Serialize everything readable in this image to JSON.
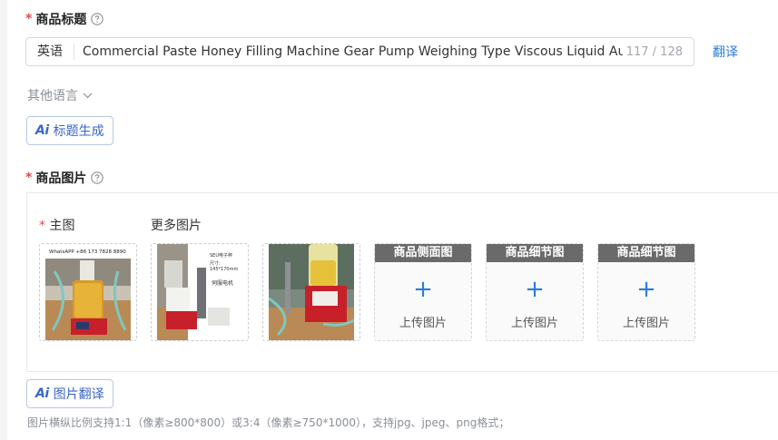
{
  "title_section": {
    "label": "商品标题",
    "language": "英语",
    "value": "Commercial Paste Honey Filling Machine Gear Pump Weighing Type Viscous Liquid Aut",
    "count": "117 / 128",
    "translate_label": "翻译",
    "other_lang_label": "其他语言",
    "ai_button_label": "标题生成"
  },
  "image_section": {
    "label": "商品图片",
    "main_label": "主图",
    "more_label": "更多图片",
    "main_image_text": "WhatsAPP +86 173 7828 8890",
    "thumb2_text_1": "SEU电子秤",
    "thumb2_text_2": "尺寸:",
    "thumb2_text_3": "145*170mm",
    "thumb2_text_4": "伺服电机",
    "slots": [
      {
        "title": "商品侧面图",
        "upload_label": "上传图片"
      },
      {
        "title": "商品细节图",
        "upload_label": "上传图片"
      },
      {
        "title": "商品细节图",
        "upload_label": "上传图片"
      }
    ],
    "ai_button_label": "图片翻译",
    "hint": "图片横纵比例支持1:1（像素≥800*800）或3:4（像素≥750*1000），支持jpg、jpeg、png格式；"
  },
  "ai_glyph": "Ai",
  "colors": {
    "accent": "#2e7bd6",
    "required": "#e5484d",
    "slot_header": "#6a6a6a"
  }
}
